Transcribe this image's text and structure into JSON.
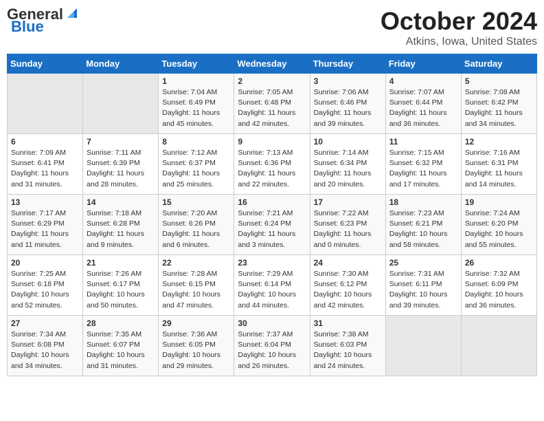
{
  "header": {
    "logo_line1": "General",
    "logo_line2": "Blue",
    "month": "October 2024",
    "location": "Atkins, Iowa, United States"
  },
  "days_of_week": [
    "Sunday",
    "Monday",
    "Tuesday",
    "Wednesday",
    "Thursday",
    "Friday",
    "Saturday"
  ],
  "weeks": [
    [
      {
        "day": "",
        "info": ""
      },
      {
        "day": "",
        "info": ""
      },
      {
        "day": "1",
        "info": "Sunrise: 7:04 AM\nSunset: 6:49 PM\nDaylight: 11 hours\nand 45 minutes."
      },
      {
        "day": "2",
        "info": "Sunrise: 7:05 AM\nSunset: 6:48 PM\nDaylight: 11 hours\nand 42 minutes."
      },
      {
        "day": "3",
        "info": "Sunrise: 7:06 AM\nSunset: 6:46 PM\nDaylight: 11 hours\nand 39 minutes."
      },
      {
        "day": "4",
        "info": "Sunrise: 7:07 AM\nSunset: 6:44 PM\nDaylight: 11 hours\nand 36 minutes."
      },
      {
        "day": "5",
        "info": "Sunrise: 7:08 AM\nSunset: 6:42 PM\nDaylight: 11 hours\nand 34 minutes."
      }
    ],
    [
      {
        "day": "6",
        "info": "Sunrise: 7:09 AM\nSunset: 6:41 PM\nDaylight: 11 hours\nand 31 minutes."
      },
      {
        "day": "7",
        "info": "Sunrise: 7:11 AM\nSunset: 6:39 PM\nDaylight: 11 hours\nand 28 minutes."
      },
      {
        "day": "8",
        "info": "Sunrise: 7:12 AM\nSunset: 6:37 PM\nDaylight: 11 hours\nand 25 minutes."
      },
      {
        "day": "9",
        "info": "Sunrise: 7:13 AM\nSunset: 6:36 PM\nDaylight: 11 hours\nand 22 minutes."
      },
      {
        "day": "10",
        "info": "Sunrise: 7:14 AM\nSunset: 6:34 PM\nDaylight: 11 hours\nand 20 minutes."
      },
      {
        "day": "11",
        "info": "Sunrise: 7:15 AM\nSunset: 6:32 PM\nDaylight: 11 hours\nand 17 minutes."
      },
      {
        "day": "12",
        "info": "Sunrise: 7:16 AM\nSunset: 6:31 PM\nDaylight: 11 hours\nand 14 minutes."
      }
    ],
    [
      {
        "day": "13",
        "info": "Sunrise: 7:17 AM\nSunset: 6:29 PM\nDaylight: 11 hours\nand 11 minutes."
      },
      {
        "day": "14",
        "info": "Sunrise: 7:18 AM\nSunset: 6:28 PM\nDaylight: 11 hours\nand 9 minutes."
      },
      {
        "day": "15",
        "info": "Sunrise: 7:20 AM\nSunset: 6:26 PM\nDaylight: 11 hours\nand 6 minutes."
      },
      {
        "day": "16",
        "info": "Sunrise: 7:21 AM\nSunset: 6:24 PM\nDaylight: 11 hours\nand 3 minutes."
      },
      {
        "day": "17",
        "info": "Sunrise: 7:22 AM\nSunset: 6:23 PM\nDaylight: 11 hours\nand 0 minutes."
      },
      {
        "day": "18",
        "info": "Sunrise: 7:23 AM\nSunset: 6:21 PM\nDaylight: 10 hours\nand 58 minutes."
      },
      {
        "day": "19",
        "info": "Sunrise: 7:24 AM\nSunset: 6:20 PM\nDaylight: 10 hours\nand 55 minutes."
      }
    ],
    [
      {
        "day": "20",
        "info": "Sunrise: 7:25 AM\nSunset: 6:18 PM\nDaylight: 10 hours\nand 52 minutes."
      },
      {
        "day": "21",
        "info": "Sunrise: 7:26 AM\nSunset: 6:17 PM\nDaylight: 10 hours\nand 50 minutes."
      },
      {
        "day": "22",
        "info": "Sunrise: 7:28 AM\nSunset: 6:15 PM\nDaylight: 10 hours\nand 47 minutes."
      },
      {
        "day": "23",
        "info": "Sunrise: 7:29 AM\nSunset: 6:14 PM\nDaylight: 10 hours\nand 44 minutes."
      },
      {
        "day": "24",
        "info": "Sunrise: 7:30 AM\nSunset: 6:12 PM\nDaylight: 10 hours\nand 42 minutes."
      },
      {
        "day": "25",
        "info": "Sunrise: 7:31 AM\nSunset: 6:11 PM\nDaylight: 10 hours\nand 39 minutes."
      },
      {
        "day": "26",
        "info": "Sunrise: 7:32 AM\nSunset: 6:09 PM\nDaylight: 10 hours\nand 36 minutes."
      }
    ],
    [
      {
        "day": "27",
        "info": "Sunrise: 7:34 AM\nSunset: 6:08 PM\nDaylight: 10 hours\nand 34 minutes."
      },
      {
        "day": "28",
        "info": "Sunrise: 7:35 AM\nSunset: 6:07 PM\nDaylight: 10 hours\nand 31 minutes."
      },
      {
        "day": "29",
        "info": "Sunrise: 7:36 AM\nSunset: 6:05 PM\nDaylight: 10 hours\nand 29 minutes."
      },
      {
        "day": "30",
        "info": "Sunrise: 7:37 AM\nSunset: 6:04 PM\nDaylight: 10 hours\nand 26 minutes."
      },
      {
        "day": "31",
        "info": "Sunrise: 7:38 AM\nSunset: 6:03 PM\nDaylight: 10 hours\nand 24 minutes."
      },
      {
        "day": "",
        "info": ""
      },
      {
        "day": "",
        "info": ""
      }
    ]
  ]
}
